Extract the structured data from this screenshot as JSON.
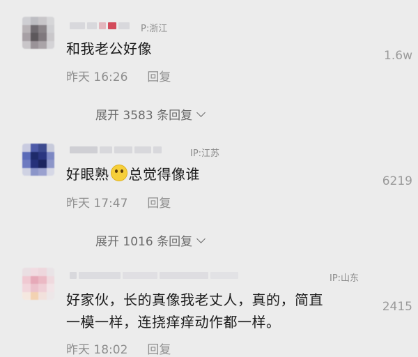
{
  "comments": [
    {
      "ip": "P:浙江",
      "content": "和我老公好像",
      "time": "昨天 16:26",
      "reply_label": "回复",
      "likes": "1.6w",
      "expand_label": "展开 3583 条回复"
    },
    {
      "ip": "IP:江苏",
      "content_before": "好眼熟",
      "emoji": "laughing-emoji",
      "content_after": "总觉得像谁",
      "time": "昨天 17:47",
      "reply_label": "回复",
      "likes": "6219",
      "expand_label": "展开 1016 条回复"
    },
    {
      "ip": "IP:山东",
      "content_line1": "好家伙，长的真像我老丈人，真的，简直",
      "content_line2": "一模一样，连挠痒痒动作都一样。",
      "time": "昨天 18:02",
      "reply_label": "回复",
      "likes": "2415"
    }
  ]
}
